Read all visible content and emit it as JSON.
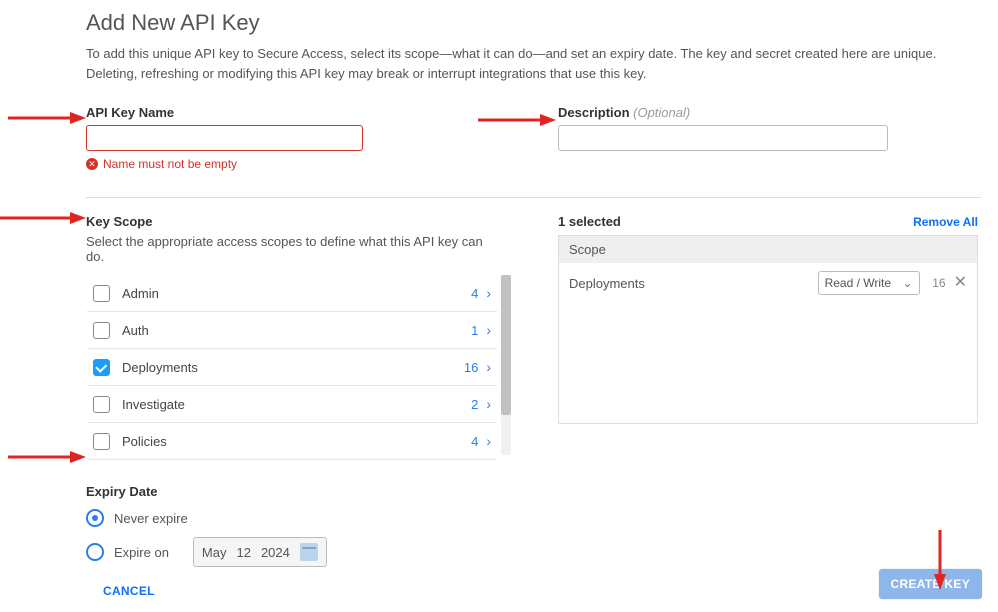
{
  "title": "Add New API Key",
  "intro": "To add this unique API key to Secure Access, select its scope—what it can do—and set an expiry date. The key and secret created here are unique. Deleting, refreshing or modifying this API key may break or interrupt integrations that use this key.",
  "name_label": "API Key Name",
  "name_value": "",
  "name_error": "Name must not be empty",
  "desc_label": "Description",
  "desc_optional": "(Optional)",
  "desc_value": "",
  "key_scope": {
    "title": "Key Scope",
    "sub": "Select the appropriate access scopes to define what this API key can do.",
    "items": [
      {
        "label": "Admin",
        "count": "4",
        "checked": false
      },
      {
        "label": "Auth",
        "count": "1",
        "checked": false
      },
      {
        "label": "Deployments",
        "count": "16",
        "checked": true
      },
      {
        "label": "Investigate",
        "count": "2",
        "checked": false
      },
      {
        "label": "Policies",
        "count": "4",
        "checked": false
      }
    ]
  },
  "selected": {
    "header": "1 selected",
    "remove_all": "Remove All",
    "col_header": "Scope",
    "rows": [
      {
        "name": "Deployments",
        "perm": "Read / Write",
        "count": "16"
      }
    ]
  },
  "expiry": {
    "title": "Expiry Date",
    "never": "Never expire",
    "on": "Expire on",
    "date": {
      "month": "May",
      "day": "12",
      "year": "2024"
    },
    "selected": "never"
  },
  "footer": {
    "cancel": "CANCEL",
    "create": "CREATE KEY"
  }
}
